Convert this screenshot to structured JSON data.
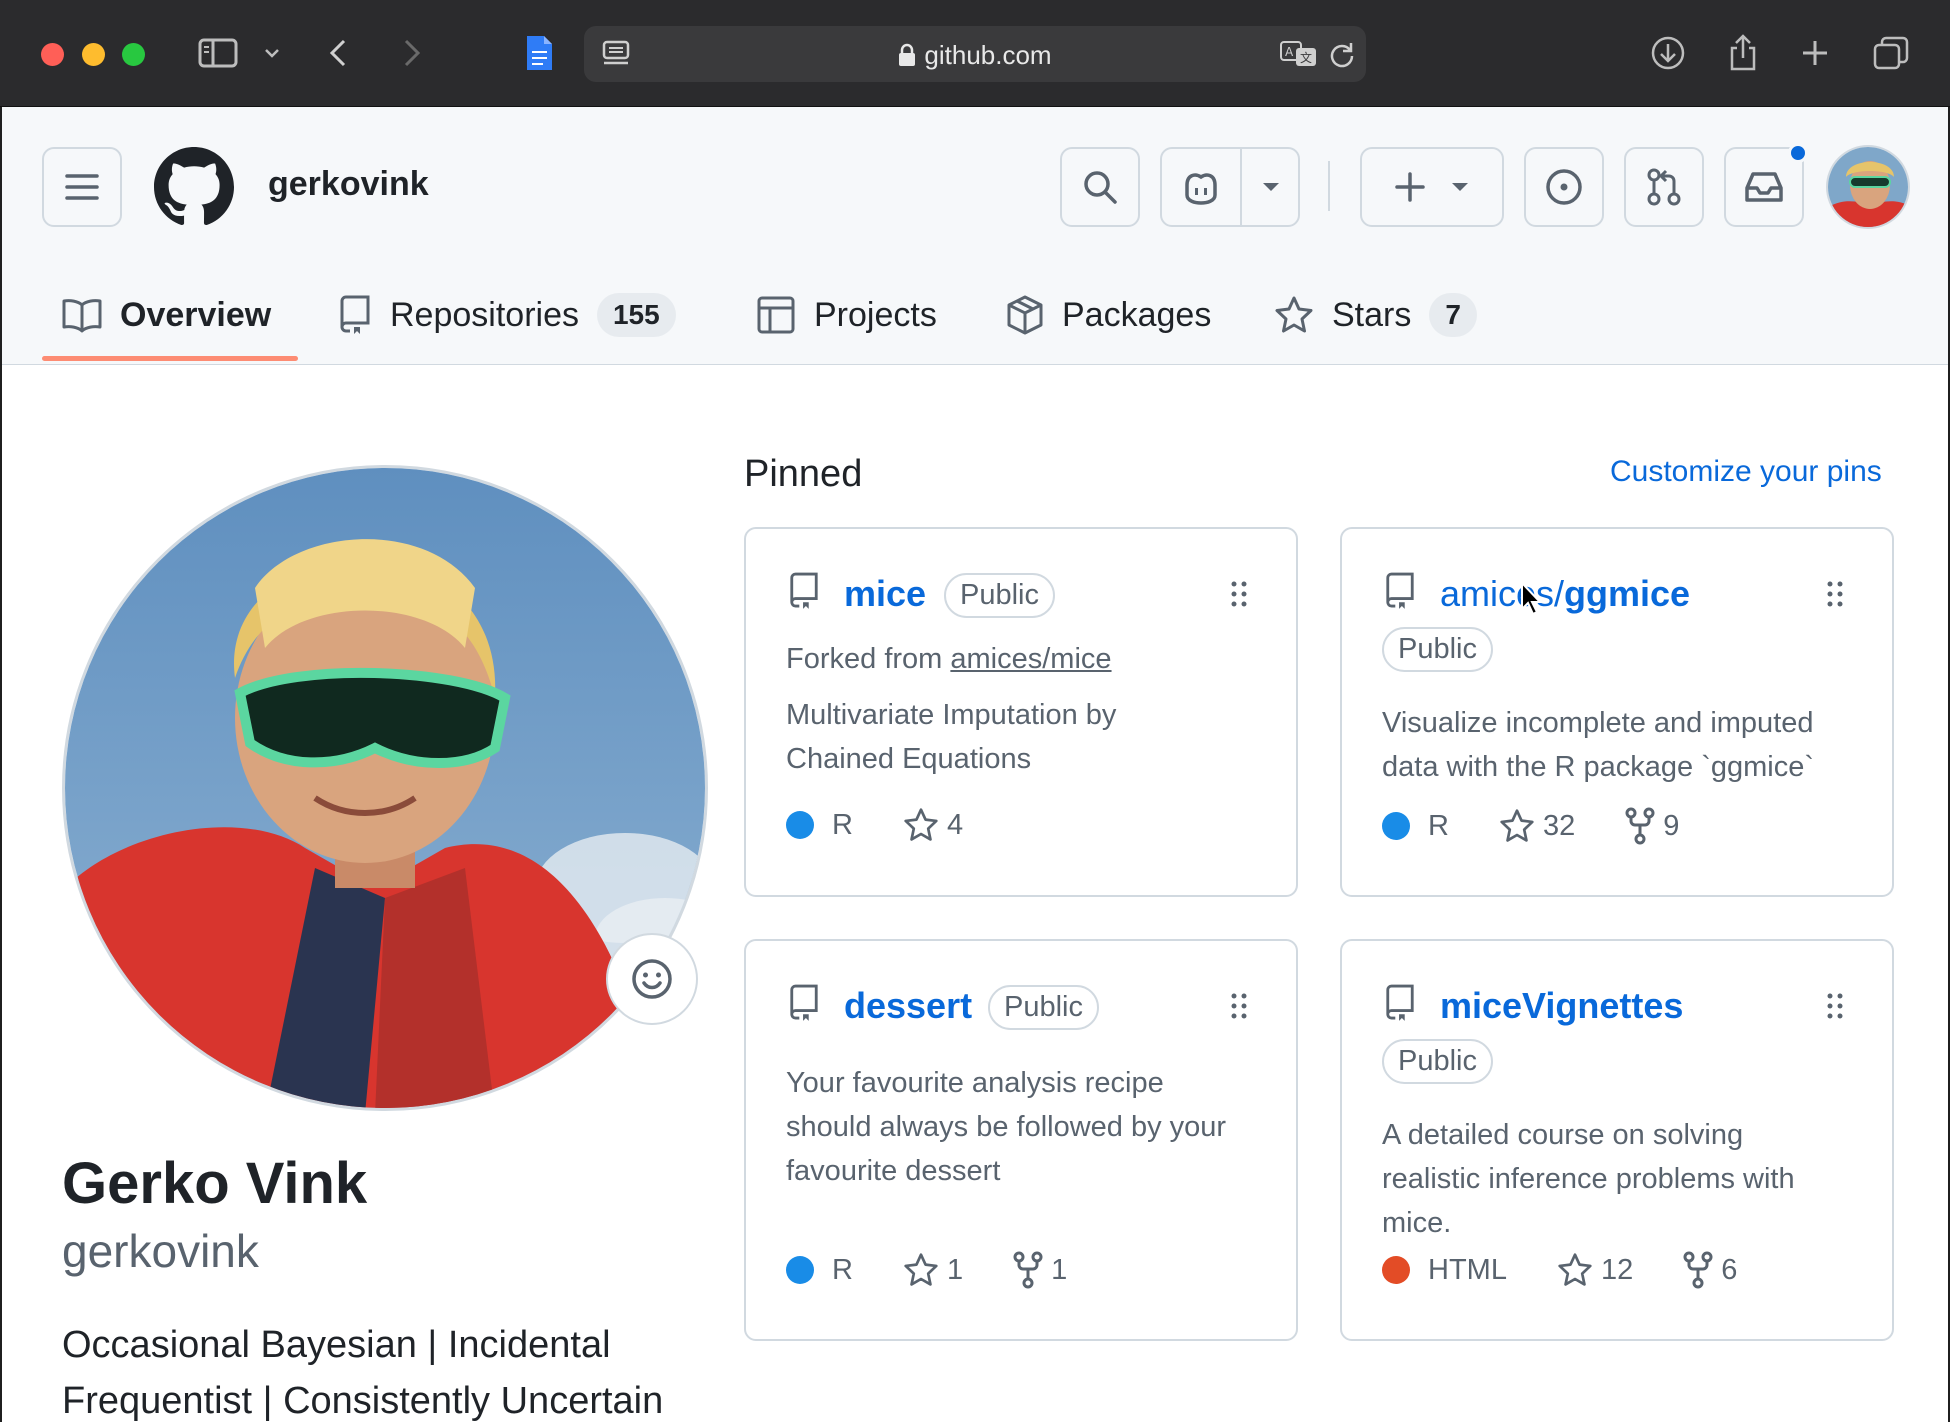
{
  "browser": {
    "url": "github.com",
    "icons": [
      "sidebar-icon",
      "chevron-down-icon",
      "back-icon",
      "forward-icon",
      "doc-icon",
      "reader-icon",
      "lock-icon",
      "translate-icon",
      "reload-icon",
      "download-icon",
      "share-icon",
      "new-tab-icon",
      "tab-overview-icon"
    ]
  },
  "header": {
    "username": "gerkovink"
  },
  "tabs": [
    {
      "label": "Overview",
      "icon": "book-icon"
    },
    {
      "label": "Repositories",
      "icon": "repo-icon",
      "count": "155"
    },
    {
      "label": "Projects",
      "icon": "table-icon"
    },
    {
      "label": "Packages",
      "icon": "package-icon"
    },
    {
      "label": "Stars",
      "icon": "star-icon",
      "count": "7"
    }
  ],
  "profile": {
    "name": "Gerko Vink",
    "login": "gerkovink",
    "bio": "Occasional Bayesian | Incidental Frequentist | Consistently Uncertain"
  },
  "pinned": {
    "title": "Pinned",
    "customize": "Customize your pins",
    "cards": [
      {
        "owner": "",
        "name": "mice",
        "visibility": "Public",
        "forked_prefix": "Forked from",
        "forked_from": "amices/mice",
        "desc_line1": "Multivariate Imputation by",
        "desc_line2": "Chained Equations",
        "language": "R",
        "lang_color": "#198CE7",
        "stars": "4"
      },
      {
        "owner": "amices/",
        "name": "ggmice",
        "visibility": "Public",
        "desc_line1": "Visualize incomplete and imputed",
        "desc_line2": "data with the R package `ggmice`",
        "language": "R",
        "lang_color": "#198CE7",
        "stars": "32",
        "forks": "9"
      },
      {
        "owner": "",
        "name": "dessert",
        "visibility": "Public",
        "desc_line1": "Your favourite analysis recipe",
        "desc_line2": "should always be followed by your",
        "desc_line3": "favourite dessert",
        "language": "R",
        "lang_color": "#198CE7",
        "stars": "1",
        "forks": "1"
      },
      {
        "owner": "",
        "name": "miceVignettes",
        "visibility": "Public",
        "desc_line1": "A detailed course on solving",
        "desc_line2": "realistic inference problems with",
        "desc_line3": "mice.",
        "language": "HTML",
        "lang_color": "#e34c26",
        "stars": "12",
        "forks": "6"
      }
    ]
  }
}
